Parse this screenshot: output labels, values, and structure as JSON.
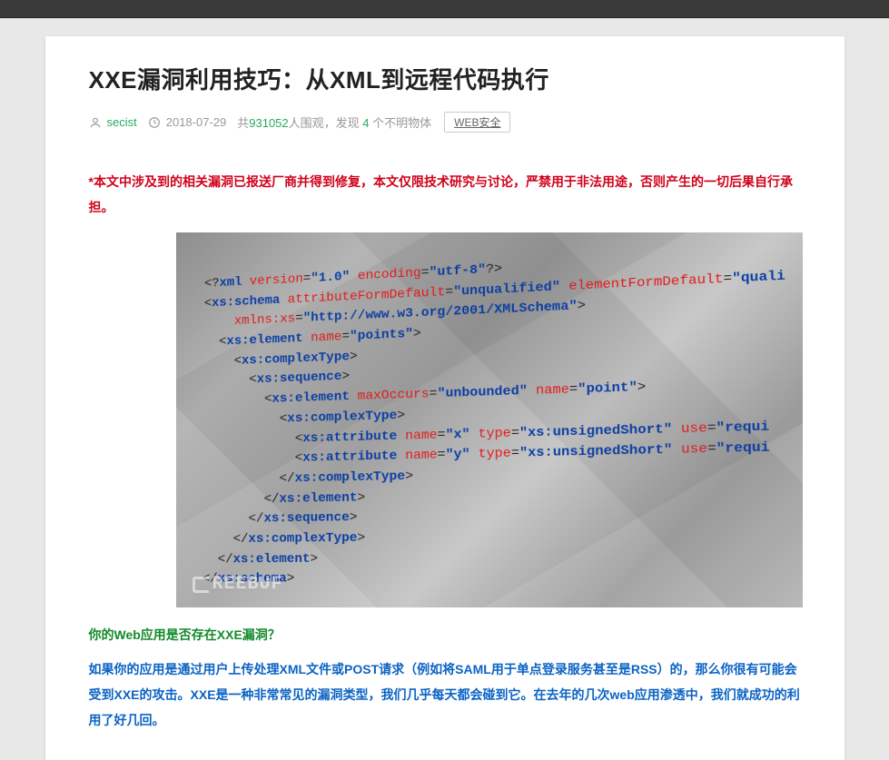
{
  "article": {
    "title": "XXE漏洞利用技巧：从XML到远程代码执行",
    "author": "secist",
    "date": "2018-07-29",
    "meta_prefix": "共",
    "views": "931052",
    "meta_mid": "人围观，发现 ",
    "found": "4",
    "meta_suffix": " 个不明物体",
    "tag": "WEB安全",
    "disclaimer": "*本文中涉及到的相关漏洞已报送厂商并得到修复，本文仅限技术研究与讨论，严禁用于非法用途，否则产生的一切后果自行承担。",
    "question": "你的Web应用是否存在XXE漏洞？",
    "intro": "如果你的应用是通过用户上传处理XML文件或POST请求（例如将SAML用于单点登录服务甚至是RSS）的，那么你很有可能会受到XXE的攻击。XXE是一种非常常见的漏洞类型，我们几乎每天都会碰到它。在去年的几次web应用渗透中，我们就成功的利用了好几回。",
    "watermark": "REEBUF"
  },
  "code": {
    "lines": [
      [
        [
          "p",
          "<?"
        ],
        [
          "t",
          "xml "
        ],
        [
          "a",
          "version"
        ],
        [
          "p",
          "="
        ],
        [
          "v",
          "\"1.0\""
        ],
        [
          "p",
          " "
        ],
        [
          "a",
          "encoding"
        ],
        [
          "p",
          "="
        ],
        [
          "v",
          "\"utf-8\""
        ],
        [
          "p",
          "?>"
        ]
      ],
      [
        [
          "p",
          "<"
        ],
        [
          "t",
          "xs:schema "
        ],
        [
          "a",
          "attributeFormDefault"
        ],
        [
          "p",
          "="
        ],
        [
          "v",
          "\"unqualified\""
        ],
        [
          "p",
          " "
        ],
        [
          "a",
          "elementFormDefault"
        ],
        [
          "p",
          "="
        ],
        [
          "v",
          "\"quali"
        ]
      ],
      [
        [
          "p",
          "    "
        ],
        [
          "a",
          "xmlns:xs"
        ],
        [
          "p",
          "="
        ],
        [
          "v",
          "\"http://www.w3.org/2001/XMLSchema\""
        ],
        [
          "p",
          ">"
        ]
      ],
      [
        [
          "p",
          "  <"
        ],
        [
          "t",
          "xs:element "
        ],
        [
          "a",
          "name"
        ],
        [
          "p",
          "="
        ],
        [
          "v",
          "\"points\""
        ],
        [
          "p",
          ">"
        ]
      ],
      [
        [
          "p",
          "    <"
        ],
        [
          "t",
          "xs:complexType"
        ],
        [
          "p",
          ">"
        ]
      ],
      [
        [
          "p",
          "      <"
        ],
        [
          "t",
          "xs:sequence"
        ],
        [
          "p",
          ">"
        ]
      ],
      [
        [
          "p",
          "        <"
        ],
        [
          "t",
          "xs:element "
        ],
        [
          "a",
          "maxOccurs"
        ],
        [
          "p",
          "="
        ],
        [
          "v",
          "\"unbounded\""
        ],
        [
          "p",
          " "
        ],
        [
          "a",
          "name"
        ],
        [
          "p",
          "="
        ],
        [
          "v",
          "\"point\""
        ],
        [
          "p",
          ">"
        ]
      ],
      [
        [
          "p",
          "          <"
        ],
        [
          "t",
          "xs:complexType"
        ],
        [
          "p",
          ">"
        ]
      ],
      [
        [
          "p",
          "            <"
        ],
        [
          "t",
          "xs:attribute "
        ],
        [
          "a",
          "name"
        ],
        [
          "p",
          "="
        ],
        [
          "v",
          "\"x\""
        ],
        [
          "p",
          " "
        ],
        [
          "a",
          "type"
        ],
        [
          "p",
          "="
        ],
        [
          "v",
          "\"xs:unsignedShort\""
        ],
        [
          "p",
          " "
        ],
        [
          "a",
          "use"
        ],
        [
          "p",
          "="
        ],
        [
          "v",
          "\"requi"
        ]
      ],
      [
        [
          "p",
          "            <"
        ],
        [
          "t",
          "xs:attribute "
        ],
        [
          "a",
          "name"
        ],
        [
          "p",
          "="
        ],
        [
          "v",
          "\"y\""
        ],
        [
          "p",
          " "
        ],
        [
          "a",
          "type"
        ],
        [
          "p",
          "="
        ],
        [
          "v",
          "\"xs:unsignedShort\""
        ],
        [
          "p",
          " "
        ],
        [
          "a",
          "use"
        ],
        [
          "p",
          "="
        ],
        [
          "v",
          "\"requi"
        ]
      ],
      [
        [
          "p",
          "          </"
        ],
        [
          "t",
          "xs:complexType"
        ],
        [
          "p",
          ">"
        ]
      ],
      [
        [
          "p",
          "        </"
        ],
        [
          "t",
          "xs:element"
        ],
        [
          "p",
          ">"
        ]
      ],
      [
        [
          "p",
          "      </"
        ],
        [
          "t",
          "xs:sequence"
        ],
        [
          "p",
          ">"
        ]
      ],
      [
        [
          "p",
          "    </"
        ],
        [
          "t",
          "xs:complexType"
        ],
        [
          "p",
          ">"
        ]
      ],
      [
        [
          "p",
          "  </"
        ],
        [
          "t",
          "xs:element"
        ],
        [
          "p",
          ">"
        ]
      ],
      [
        [
          "p",
          "</"
        ],
        [
          "t",
          "xs:schema"
        ],
        [
          "p",
          ">"
        ]
      ]
    ]
  }
}
